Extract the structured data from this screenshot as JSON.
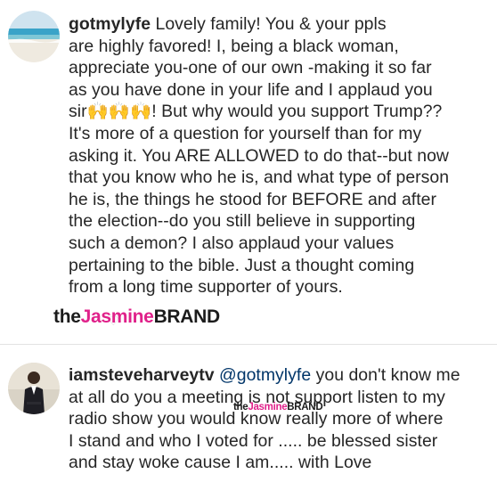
{
  "comments": [
    {
      "username": "gotmylyfe",
      "lines": [
        "Lovely family! You & your ppls",
        "are highly favored! I, being a black woman,",
        "appreciate you-one of our own -making it so far",
        "as you have done in your life and I applaud you",
        "sir",
        "! But why would you support Trump??",
        "It's more of a question for yourself than for my",
        "asking it. You ARE ALLOWED to do that--but now",
        "that you know who he is, and what type of person",
        "he is, the things he stood for BEFORE and after",
        "the election--do you still believe in supporting",
        "such a demon? I also applaud your values",
        "pertaining to the bible. Just a thought coming",
        "from a long time supporter of yours."
      ],
      "emoji": "🙌🙌🙌"
    },
    {
      "username": "iamsteveharveytv",
      "mention": "@gotmylyfe",
      "lines": [
        "you don't know me",
        "at all do you a meeting is not support listen to my",
        "radio show you would know really more of where",
        "I stand and who I voted for ..... be blessed sister",
        "and stay woke cause I am..... with Love"
      ]
    }
  ],
  "watermark": {
    "part1": "the",
    "part2": "Jasmine",
    "part3": "BRAND"
  },
  "colors": {
    "text": "#262626",
    "watermark_pink": "#e0218a",
    "mention": "#003569",
    "divider": "#e3e3e3"
  }
}
